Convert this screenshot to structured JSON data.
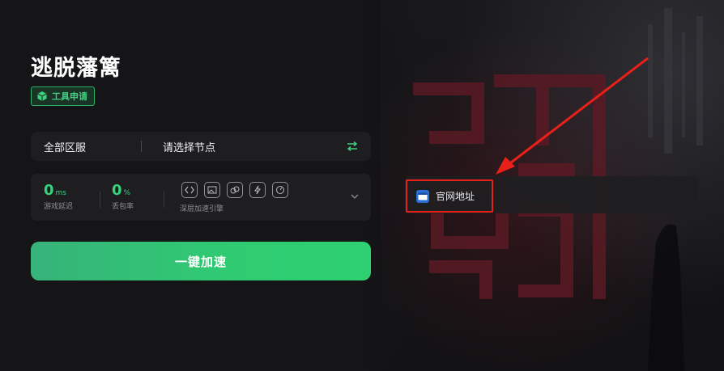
{
  "game": {
    "title": "逃脱藩篱"
  },
  "badge": {
    "label": "工具申请",
    "icon": "cube-icon"
  },
  "node_bar": {
    "region": "全部区服",
    "node": "请选择节点",
    "swap_icon": "swap-arrows-icon"
  },
  "stats": {
    "latency": {
      "value": "0",
      "unit": "ms",
      "label": "游戏延迟"
    },
    "loss": {
      "value": "0",
      "unit": "%",
      "label": "丢包率"
    },
    "engine_label": "深层加速引擎",
    "engine_icons": [
      "code-icon",
      "image-icon",
      "link-icon",
      "bolt-icon",
      "speed-icon"
    ]
  },
  "accelerate": {
    "label": "一键加速"
  },
  "site": {
    "label": "官网地址",
    "icon": "browser-icon"
  },
  "colors": {
    "accent": "#2ecb72",
    "highlight": "#e8201a",
    "background": "#141416"
  }
}
